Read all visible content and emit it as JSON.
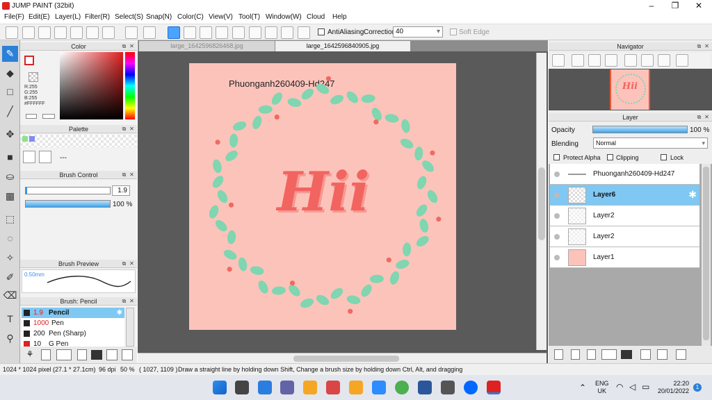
{
  "window": {
    "title": "JUMP PAINT (32bit)",
    "minimize": "–",
    "maximize": "❐",
    "close": "✕"
  },
  "menu": [
    "File(F)",
    "Edit(E)",
    "Layer(L)",
    "Filter(R)",
    "Select(S)",
    "Snap(N)",
    "Color(C)",
    "View(V)",
    "Tool(T)",
    "Window(W)",
    "Cloud",
    "Help"
  ],
  "toolbar": {
    "antialias_label": "AntiAliasing",
    "correction_label": "Correction",
    "correction_value": "40",
    "soft_edge_label": "Soft Edge"
  },
  "tabs": [
    "large_1642596826468.jpg",
    "large_1642596840905.jpg"
  ],
  "color_panel": {
    "title": "Color",
    "r": "R:255",
    "g": "G:255",
    "b": "B:255",
    "hex": "#FFFFFF"
  },
  "palette_panel": {
    "title": "Palette",
    "empty_label": "---"
  },
  "brush_control": {
    "title": "Brush Control",
    "size_value": "1.9",
    "opacity_value": "100 %",
    "opacity_fraction": 1.0
  },
  "brush_preview": {
    "title": "Brush Preview",
    "size_label": "0.50mm"
  },
  "brush_list": {
    "title": "Brush: Pencil",
    "items": [
      {
        "size": "1.9",
        "name": "Pencil",
        "selected": true
      },
      {
        "size": "1000",
        "name": "Pen",
        "selected": false
      },
      {
        "size": "200",
        "name": "Pen (Sharp)",
        "selected": false
      },
      {
        "size": "10",
        "name": "G Pen",
        "selected": false
      }
    ]
  },
  "artwork": {
    "watermark": "Phuonganh260409-Hd247",
    "heading": "Hii"
  },
  "navigator": {
    "title": "Navigator"
  },
  "layer_panel": {
    "title": "Layer",
    "opacity_label": "Opacity",
    "opacity_value": "100 %",
    "opacity_fraction": 1.0,
    "blending_label": "Blending",
    "blending_value": "Normal",
    "protect_alpha": "Protect Alpha",
    "clipping": "Clipping",
    "lock": "Lock",
    "layers": [
      {
        "name": "Phuonganh260409-Hd247",
        "selected": false
      },
      {
        "name": "Layer6",
        "selected": true
      },
      {
        "name": "Layer2",
        "selected": false
      },
      {
        "name": "Layer2",
        "selected": false
      },
      {
        "name": "Layer1",
        "selected": false
      }
    ]
  },
  "status": {
    "size": "1024 * 1024 pixel",
    "physical": "(27.1 * 27.1cm)",
    "dpi": "96 dpi",
    "zoom": "50 %",
    "coords": "( 1027, 1109 )",
    "hint": "Draw a straight line by holding down Shift, Change a brush size by holding down Ctrl, Alt, and dragging"
  },
  "taskbar": {
    "lang_top": "ENG",
    "lang_bottom": "UK",
    "time": "22:20",
    "date": "20/01/2022",
    "notif": "1"
  },
  "colors": {
    "accent": "#2b80d8",
    "canvas_bg": "#fcc3bb",
    "leaf": "#7fd6b0",
    "berry": "#f06a60",
    "title_red": "#f26460"
  }
}
